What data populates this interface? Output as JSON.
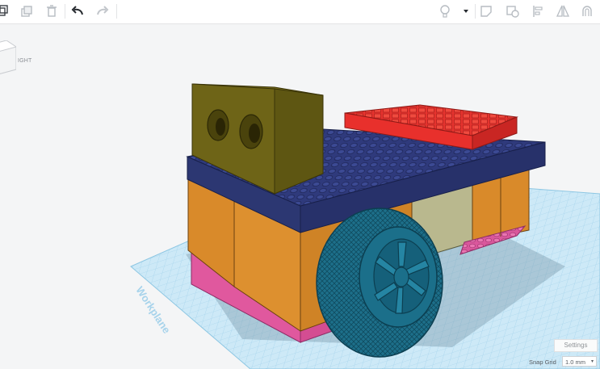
{
  "toolbar": {
    "left_tools": [
      "copy-icon",
      "duplicate-icon",
      "delete-icon",
      "undo-icon",
      "redo-icon"
    ],
    "right_tools": [
      "light-bulb-icon",
      "dropdown-arrow-icon",
      "group-icon",
      "ungroup-icon",
      "align-icon",
      "flip-icon",
      "workplane-magnet-icon"
    ]
  },
  "viewcube": {
    "face_label": "RIGHT",
    "visible_label": "IGHT"
  },
  "workplane": {
    "label": "Workplane"
  },
  "settings": {
    "button_label": "Settings"
  },
  "snap_grid": {
    "label": "Snap Grid",
    "value": "1.0 mm",
    "arrow": "▾"
  },
  "colors": {
    "background": "#f4f5f6",
    "grid": "#b9e1f4",
    "navy_plate": "#2e3a7a",
    "orange_block": "#d98a2a",
    "pink_base": "#e0589e",
    "red_block": "#e8302c",
    "olive_sensor": "#6e6417",
    "wheel": "#1b6f8a",
    "khaki_block": "#b9b88e"
  }
}
